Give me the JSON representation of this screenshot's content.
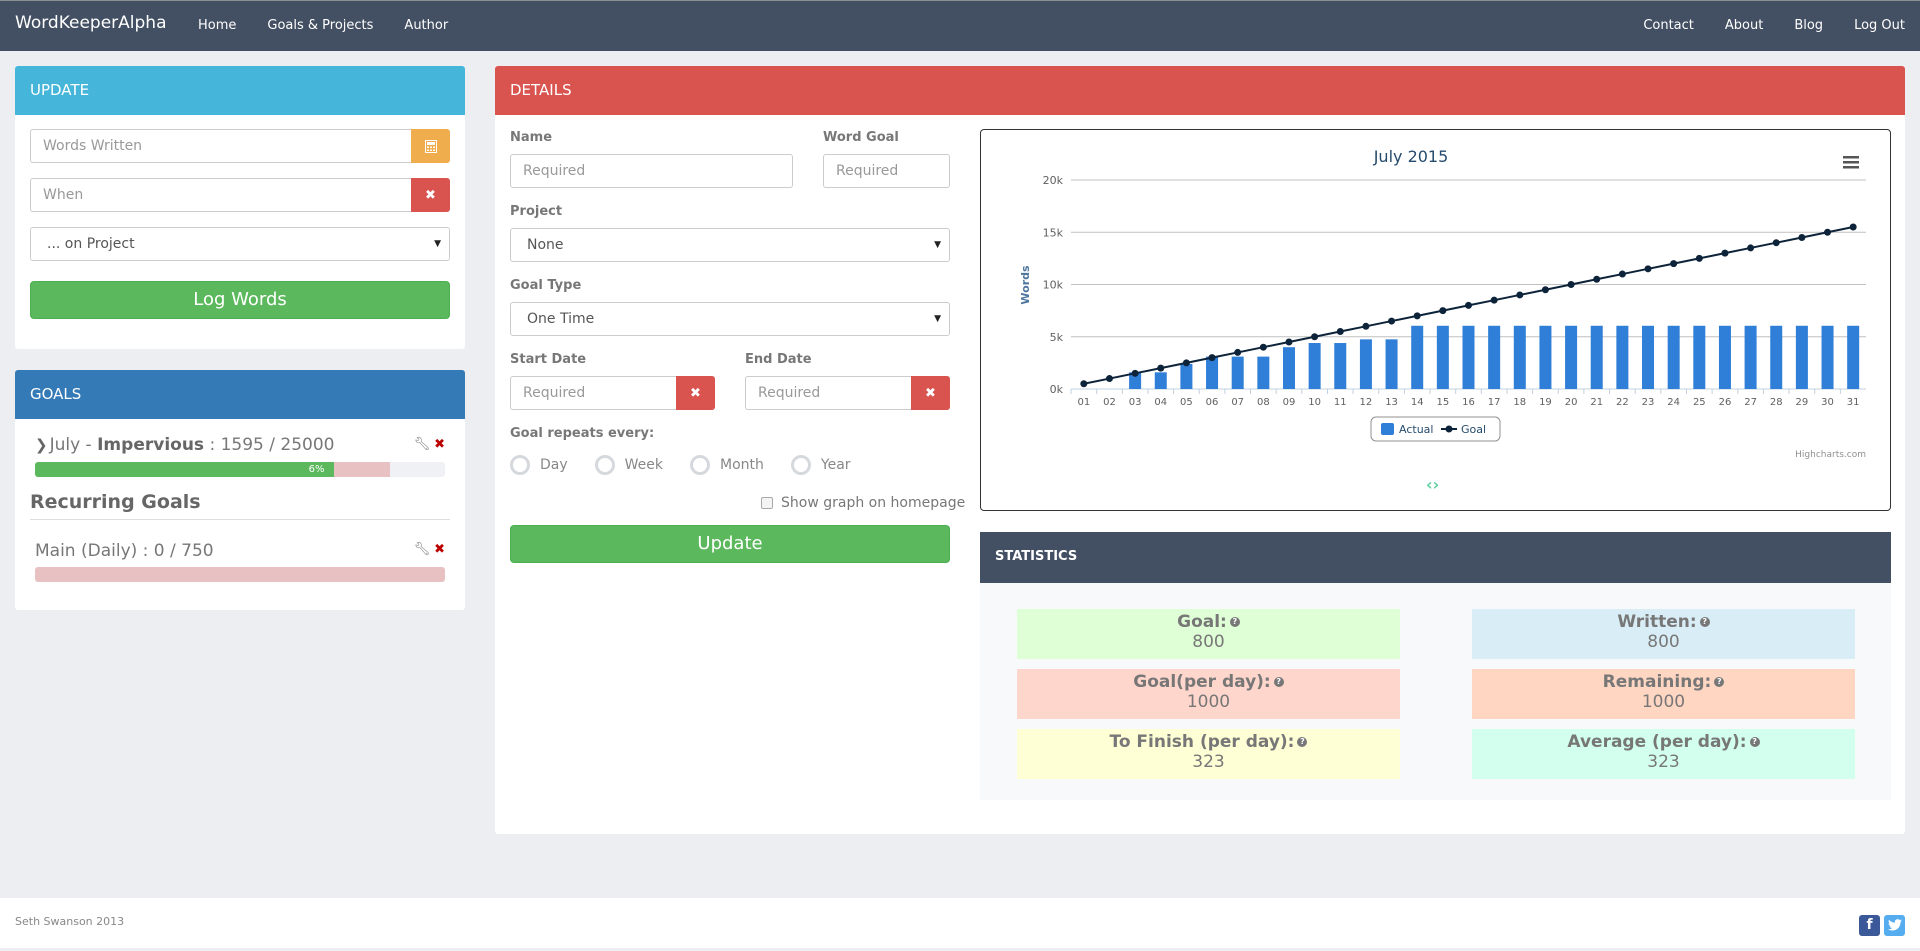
{
  "navbar": {
    "brand": "WordKeeperAlpha",
    "left_links": [
      "Home",
      "Goals & Projects",
      "Author"
    ],
    "right_links": [
      "Contact",
      "About",
      "Blog",
      "Log Out"
    ]
  },
  "update_panel": {
    "title": "UPDATE",
    "words_placeholder": "Words Written",
    "words_addon_icon": "calculator-icon",
    "when_placeholder": "When",
    "when_addon_icon": "clear-icon",
    "project_select": "... on Project",
    "log_button": "Log Words"
  },
  "goals_panel": {
    "title": "GOALS",
    "goal": {
      "month": "July",
      "separator": " - ",
      "name": "Impervious",
      "progress_text": " : 1595 / 25000",
      "percent_label": "6%",
      "percent": 6,
      "expected_percent": 88
    },
    "recurring_heading": "Recurring Goals",
    "recurring": {
      "label": "Main (Daily) : 0 / 750",
      "percent": 0
    }
  },
  "details_panel": {
    "title": "DETAILS",
    "name_label": "Name",
    "name_placeholder": "Required",
    "word_goal_label": "Word Goal",
    "word_goal_placeholder": "Required",
    "project_label": "Project",
    "project_value": "None",
    "goal_type_label": "Goal Type",
    "goal_type_value": "One Time",
    "start_label": "Start Date",
    "start_placeholder": "Required",
    "end_label": "End Date",
    "end_placeholder": "Required",
    "repeat_label": "Goal repeats every:",
    "repeat_options": [
      "Day",
      "Week",
      "Month",
      "Year"
    ],
    "show_graph_label": "Show graph on homepage",
    "update_button": "Update"
  },
  "chart_data": {
    "type": "bar",
    "title": "July 2015",
    "xlabel": "",
    "ylabel": "Words",
    "ylim": [
      0,
      20000
    ],
    "y_ticks": [
      "0k",
      "5k",
      "10k",
      "15k",
      "20k"
    ],
    "categories": [
      "01",
      "02",
      "03",
      "04",
      "05",
      "06",
      "07",
      "08",
      "09",
      "10",
      "11",
      "12",
      "13",
      "14",
      "15",
      "16",
      "17",
      "18",
      "19",
      "20",
      "21",
      "22",
      "23",
      "24",
      "25",
      "26",
      "27",
      "28",
      "29",
      "30",
      "31"
    ],
    "series": [
      {
        "name": "Actual",
        "type": "column",
        "color": "#2f7ed8",
        "values": [
          0,
          0,
          1595,
          1595,
          2400,
          3100,
          3100,
          3100,
          4000,
          4400,
          4400,
          4750,
          4750,
          6050,
          6050,
          6050,
          6050,
          6050,
          6050,
          6050,
          6050,
          6050,
          6050,
          6050,
          6050,
          6050,
          6050,
          6050,
          6050,
          6050,
          6050
        ]
      },
      {
        "name": "Goal",
        "type": "line",
        "color": "#0d233a",
        "values": [
          500,
          1000,
          1500,
          2000,
          2500,
          3000,
          3500,
          4000,
          4500,
          5000,
          5500,
          6000,
          6500,
          7000,
          7500,
          8000,
          8500,
          9000,
          9500,
          10000,
          10500,
          11000,
          11500,
          12000,
          12500,
          13000,
          13500,
          14000,
          14500,
          15000,
          15500
        ]
      }
    ],
    "grid": true,
    "legend": "bottom-center",
    "credits": "Highcharts.com"
  },
  "chart_pager": "‹ ›",
  "statistics": {
    "title": "STATISTICS",
    "items": [
      {
        "label": "Goal:",
        "value": "800",
        "color": "#dfffd6"
      },
      {
        "label": "Written:",
        "value": "800",
        "color": "#d9edf7"
      },
      {
        "label": "Goal(per day):",
        "value": "1000",
        "color": "#ffd6cc"
      },
      {
        "label": "Remaining:",
        "value": "1000",
        "color": "#ffd6c2"
      },
      {
        "label": "To Finish (per day):",
        "value": "323",
        "color": "#ffffd6"
      },
      {
        "label": "Average (per day):",
        "value": "323",
        "color": "#d2ffee"
      }
    ]
  },
  "footer": {
    "copyright": "Seth Swanson 2013",
    "facebook": "f",
    "twitter": "t"
  }
}
